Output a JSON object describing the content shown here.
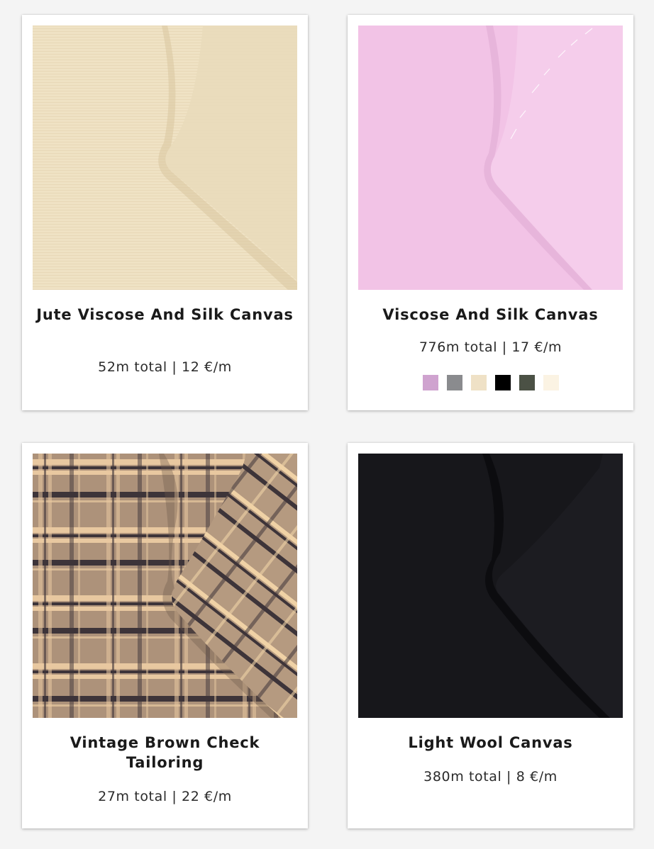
{
  "products": [
    {
      "name": "Jute Viscose And Silk Canvas",
      "meta": "52m total | 12 €/m",
      "base_color": "#efe2c4",
      "colors": []
    },
    {
      "name": "Viscose And Silk Canvas",
      "meta": "776m total | 17 €/m",
      "base_color": "#f2c3e6",
      "colors": [
        "#cfa3cf",
        "#8a8b8e",
        "#efe1c6",
        "#000000",
        "#4b5145",
        "#fbf3e3"
      ]
    },
    {
      "name": "Vintage Brown Check Tailoring",
      "meta": "27m total | 22 €/m",
      "base_color": "#b69c83",
      "colors": []
    },
    {
      "name": "Light Wool Canvas",
      "meta": "380m total | 8 €/m",
      "base_color": "#17171b",
      "colors": []
    }
  ]
}
